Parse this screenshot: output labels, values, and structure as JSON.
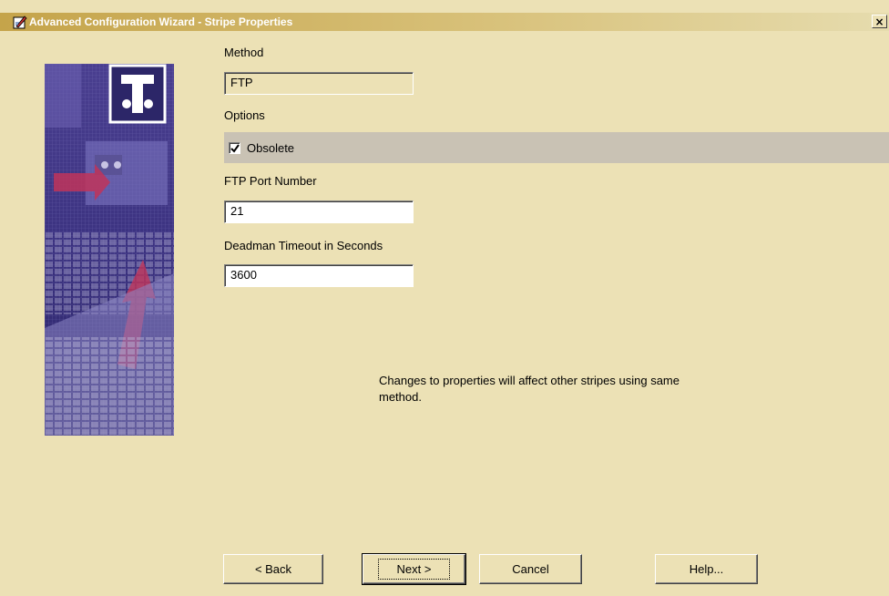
{
  "window": {
    "title": "Advanced Configuration Wizard - Stripe Properties",
    "close_glyph": "×"
  },
  "form": {
    "method_label": "Method",
    "method_value": "FTP",
    "options_label": "Options",
    "obsolete_label": "Obsolete",
    "obsolete_checked": true,
    "port_label": "FTP Port Number",
    "port_value": "21",
    "timeout_label": "Deadman Timeout in Seconds",
    "timeout_value": "3600"
  },
  "note": "Changes to properties will affect other stripes using same method.",
  "buttons": {
    "back": "< Back",
    "next": "Next >",
    "cancel": "Cancel",
    "help": "Help..."
  },
  "colors": {
    "dialog_bg": "#ece1b5",
    "titlebar_start": "#c5a44a",
    "options_band": "#c9c2b4",
    "art_purple": "#3a2f7a"
  }
}
